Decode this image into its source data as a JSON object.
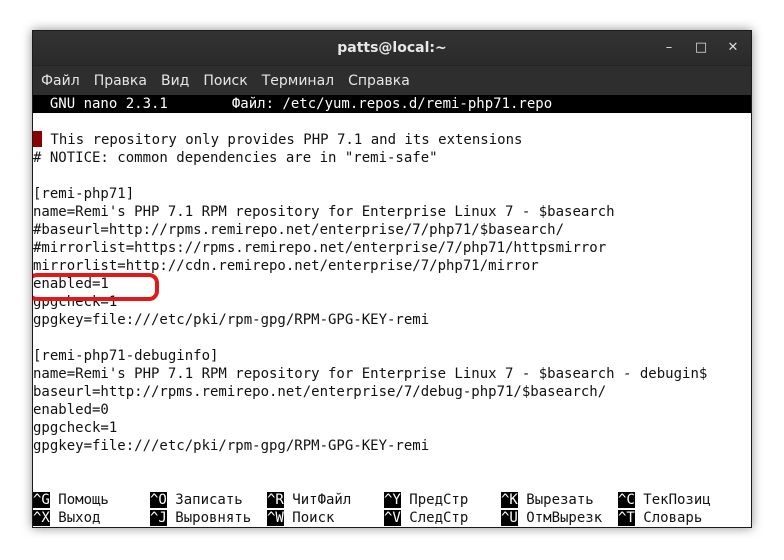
{
  "window": {
    "title": "patts@local:~",
    "controls": {
      "minimize": "–",
      "maximize": "□",
      "close": "✕"
    }
  },
  "menu": [
    "Файл",
    "Правка",
    "Вид",
    "Поиск",
    "Терминал",
    "Справка"
  ],
  "nano": {
    "version": "  GNU nano 2.3.1",
    "file": "Файл: /etc/yum.repos.d/remi-php71.repo"
  },
  "content": {
    "line1_rest": " This repository only provides PHP 7.1 and its extensions",
    "lines": [
      "# NOTICE: common dependencies are in \"remi-safe\"",
      "",
      "[remi-php71]",
      "name=Remi's PHP 7.1 RPM repository for Enterprise Linux 7 - $basearch",
      "#baseurl=http://rpms.remirepo.net/enterprise/7/php71/$basearch/",
      "#mirrorlist=https://rpms.remirepo.net/enterprise/7/php71/httpsmirror",
      "mirrorlist=http://cdn.remirepo.net/enterprise/7/php71/mirror",
      "enabled=1",
      "gpgcheck=1",
      "gpgkey=file:///etc/pki/rpm-gpg/RPM-GPG-KEY-remi",
      "",
      "[remi-php71-debuginfo]",
      "name=Remi's PHP 7.1 RPM repository for Enterprise Linux 7 - $basearch - debugin$",
      "baseurl=http://rpms.remirepo.net/enterprise/7/debug-php71/$basearch/",
      "enabled=0",
      "gpgcheck=1",
      "gpgkey=file:///etc/pki/rpm-gpg/RPM-GPG-KEY-remi"
    ]
  },
  "shortcuts": [
    [
      {
        "key": "^G",
        "label": " Помощь"
      },
      {
        "key": "^O",
        "label": " Записать"
      },
      {
        "key": "^R",
        "label": " ЧитФайл"
      },
      {
        "key": "^Y",
        "label": " ПредСтр"
      },
      {
        "key": "^K",
        "label": " Вырезать"
      },
      {
        "key": "^C",
        "label": " ТекПозиц"
      }
    ],
    [
      {
        "key": "^X",
        "label": " Выход"
      },
      {
        "key": "^J",
        "label": " Выровнять"
      },
      {
        "key": "^W",
        "label": " Поиск"
      },
      {
        "key": "^V",
        "label": " СледСтр"
      },
      {
        "key": "^U",
        "label": " ОтмВырезк"
      },
      {
        "key": "^T",
        "label": " Словарь"
      }
    ]
  ],
  "colors": {
    "titlebar": "#2e2e2e",
    "cursor": "#8b0000",
    "highlight": "#e11919"
  }
}
